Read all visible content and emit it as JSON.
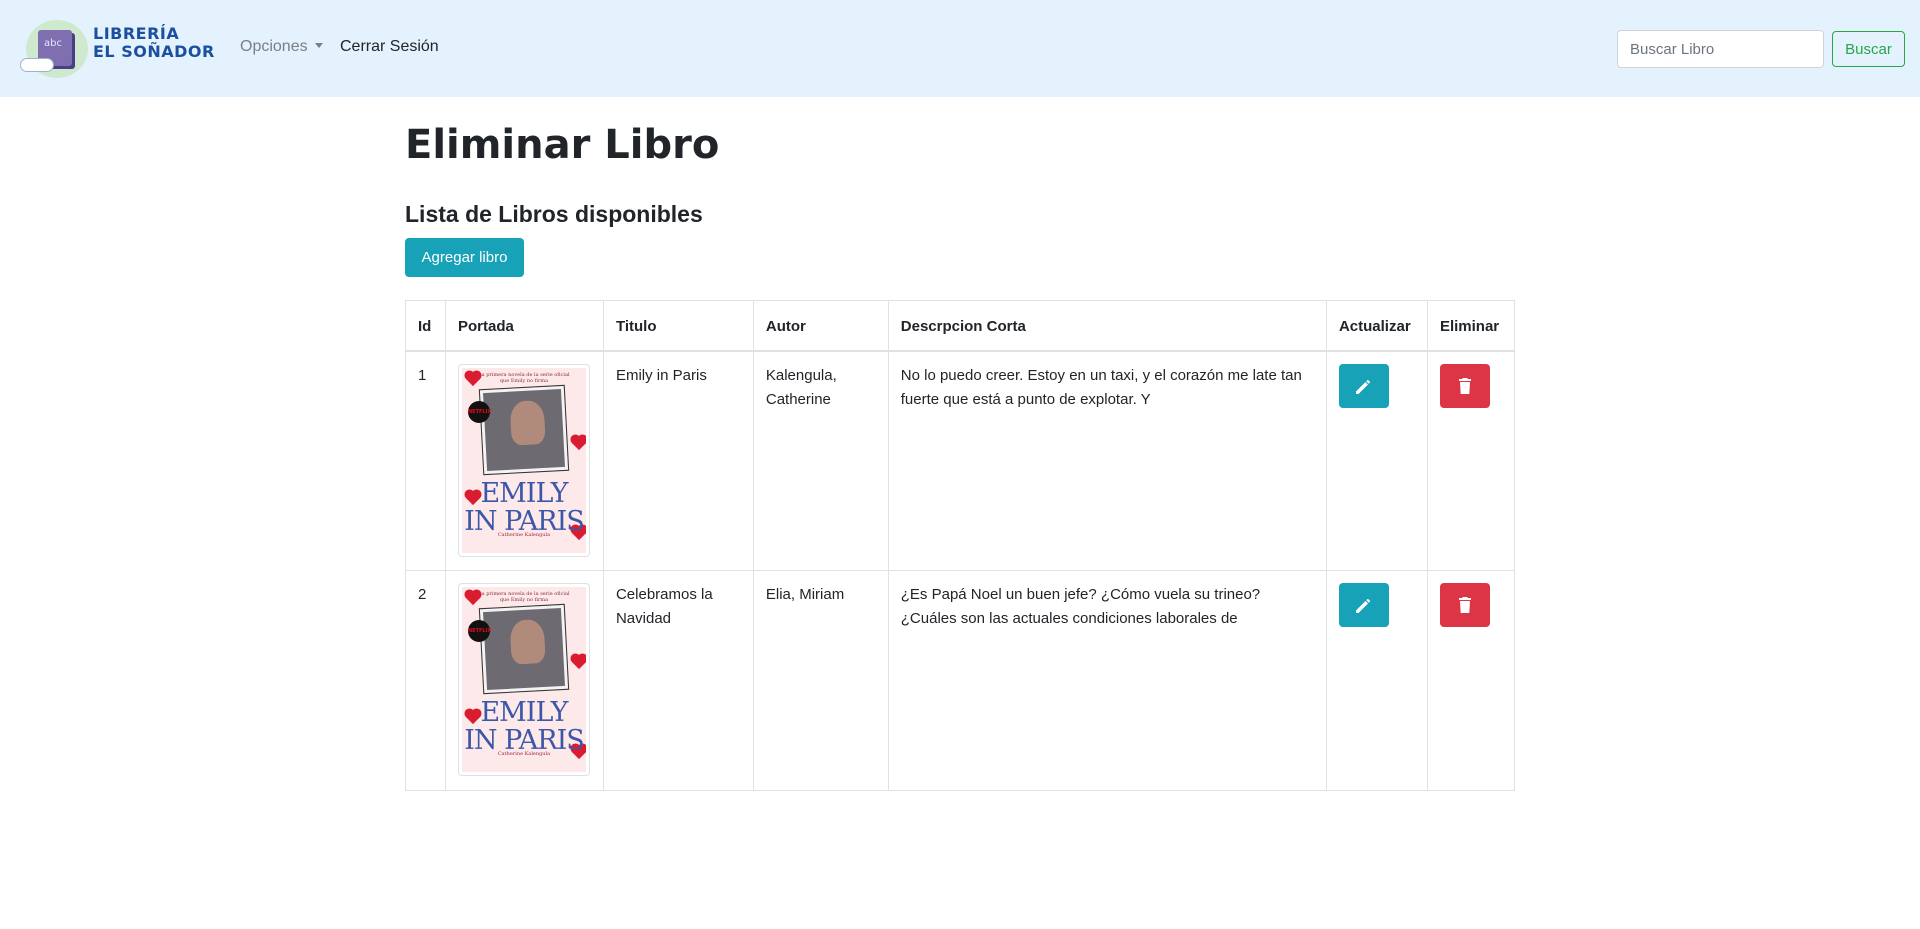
{
  "brand": {
    "line1": "LIBRERÍA",
    "line2": "EL SOÑADOR",
    "book_text": "abc"
  },
  "nav": {
    "options_label": "Opciones",
    "logout_label": "Cerrar Sesión"
  },
  "search": {
    "placeholder": "Buscar Libro",
    "value": "",
    "button_label": "Buscar"
  },
  "main": {
    "title": "Eliminar Libro",
    "subtitle": "Lista de Libros disponibles",
    "add_button_label": "Agregar libro"
  },
  "table": {
    "headers": [
      "Id",
      "Portada",
      "Titulo",
      "Autor",
      "Descrpcion Corta",
      "Actualizar",
      "Eliminar"
    ],
    "rows": [
      {
        "id": "1",
        "titulo": "Emily in Paris",
        "autor": "Kalengula, Catherine",
        "descripcion": "No lo puedo creer. Estoy en un taxi, y el corazón me late tan fuerte que está a punto de explotar. Y"
      },
      {
        "id": "2",
        "titulo": "Celebramos la Navidad",
        "autor": "Elia, Miriam",
        "descripcion": "¿Es Papá Noel un buen jefe? ¿Cómo vuela su trineo? ¿Cuáles son las actuales condiciones laborales de"
      }
    ]
  },
  "cover": {
    "tagline": "La primera novela de la serie oficial que Emily no firma",
    "badge": "NETFLIX",
    "title_line1": "EMILY",
    "title_line2": "IN PARIS",
    "author": "Catherine Kalengula"
  },
  "colors": {
    "navbar_bg": "#e3f2fd",
    "info": "#17a2b8",
    "danger": "#dc3545",
    "success": "#28a745"
  },
  "icons": {
    "edit": "pencil-icon",
    "delete": "trash-icon",
    "dropdown": "caret-down-icon"
  }
}
